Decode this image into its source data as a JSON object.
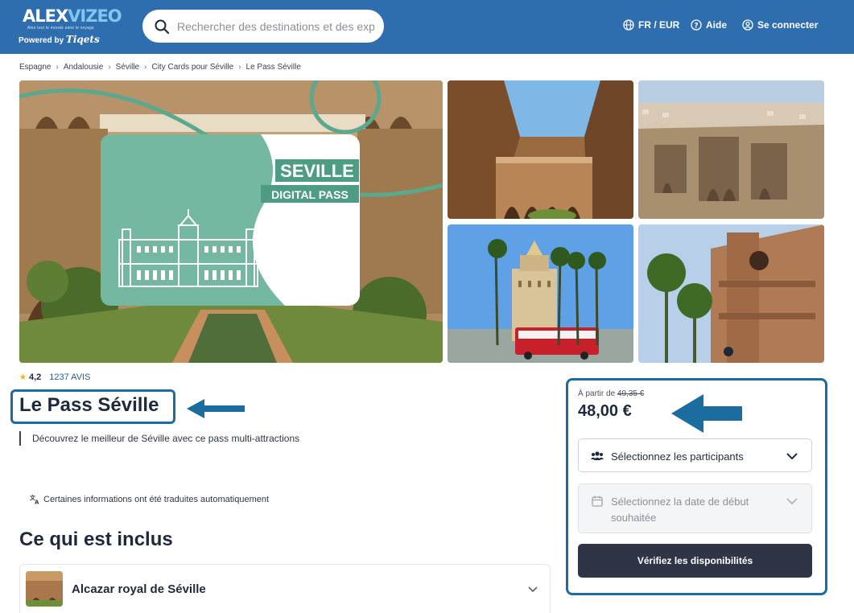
{
  "header": {
    "logo_main": "ALEX",
    "logo_accent": "VIZEO",
    "logo_tagline": "Alex tout le monde aime le voyage",
    "powered_by": "Powered by",
    "powered_brand": "Tiqets",
    "search_placeholder": "Rechercher des destinations et des expé",
    "lang_currency": "FR / EUR",
    "help": "Aide",
    "login": "Se connecter"
  },
  "breadcrumb": [
    "Espagne",
    "Andalousie",
    "Séville",
    "City Cards pour Séville",
    "Le Pass Séville"
  ],
  "gallery": {
    "card_line1": "SEVILLE",
    "card_line2": "DIGITAL PASS"
  },
  "product": {
    "rating": "4,2",
    "reviews": "1237 AVIS",
    "title": "Le Pass Séville",
    "subtitle": "Découvrez le meilleur de Séville avec ce pass multi-attractions",
    "translated_note": "Certaines informations ont été traduites automatiquement",
    "included_heading": "Ce qui est inclus",
    "included_items": [
      {
        "label": "Alcazar royal de Séville"
      }
    ]
  },
  "booking": {
    "price_from_label": "À partir de",
    "old_price": "49,35 €",
    "price": "48,00 €",
    "participants_label": "Sélectionnez les participants",
    "date_label": "Sélectionnez la date de début souhaitée",
    "check_button": "Vérifiez les disponibilités"
  },
  "colors": {
    "header_bg": "#2f6eae",
    "annotation_blue": "#1a6d9e",
    "button_dark": "#2f3447",
    "card_green": "#74b8a2"
  }
}
